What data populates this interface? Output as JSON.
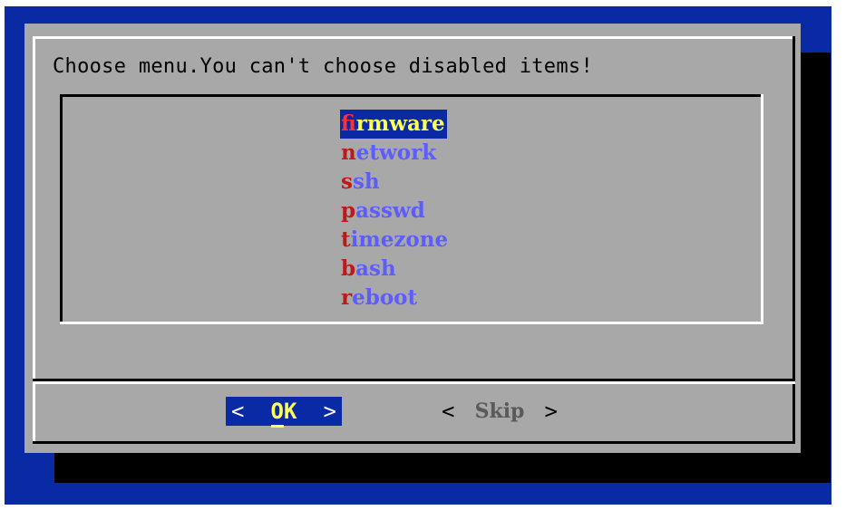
{
  "dialog": {
    "title": "Choose menu.You can't choose disabled items!",
    "menu": [
      {
        "hotkey": "f",
        "rest": "irmware",
        "selected": true
      },
      {
        "hotkey": "n",
        "rest": "etwork",
        "selected": false
      },
      {
        "hotkey": "s",
        "rest": "sh",
        "selected": false
      },
      {
        "hotkey": "p",
        "rest": "asswd",
        "selected": false
      },
      {
        "hotkey": "t",
        "rest": "imezone",
        "selected": false
      },
      {
        "hotkey": "b",
        "rest": "ash",
        "selected": false
      },
      {
        "hotkey": "r",
        "rest": "eboot",
        "selected": false
      }
    ],
    "buttons": {
      "ok": {
        "left": "<",
        "label": "OK",
        "right": ">"
      },
      "skip": {
        "left": "<",
        "label": "Skip",
        "right": ">"
      }
    }
  },
  "colors": {
    "background": "#0a2aa5",
    "dialog": "#a8a8a8",
    "shadow": "#000000",
    "item_text": "#5d5dff",
    "hotkey": "#c01818",
    "highlight_text": "#ffff54"
  }
}
